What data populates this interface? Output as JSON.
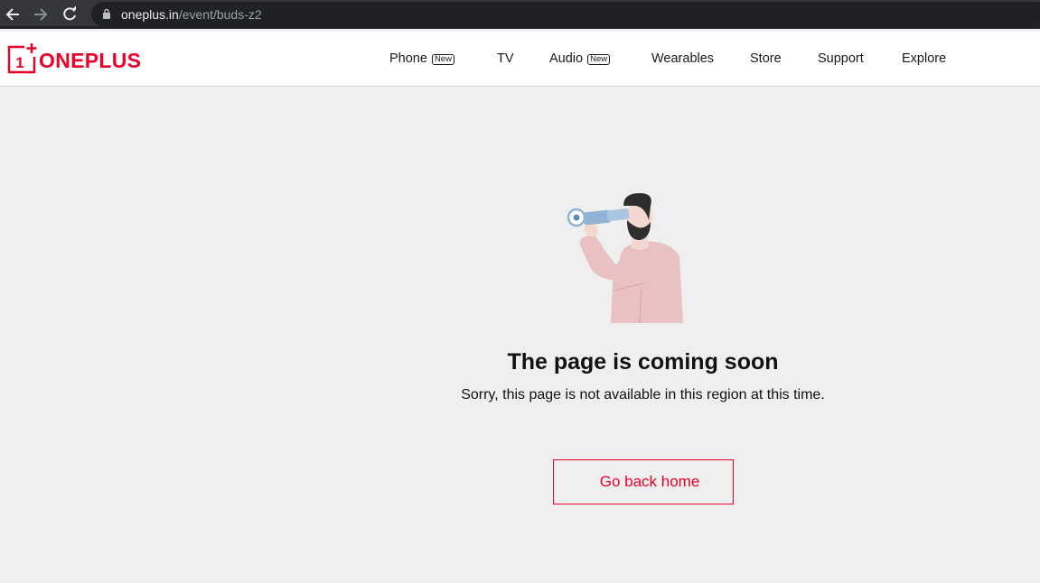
{
  "browser": {
    "url_host": "oneplus.in",
    "url_path": "/event/buds-z2"
  },
  "header": {
    "logo_text": "ONEPLUS",
    "logo_mark_text": "1",
    "nav": [
      {
        "label": "Phone",
        "badge": "New"
      },
      {
        "label": "TV"
      },
      {
        "label": "Audio",
        "badge": "New"
      },
      {
        "label": "Wearables"
      },
      {
        "label": "Store"
      },
      {
        "label": "Support"
      },
      {
        "label": "Explore"
      }
    ]
  },
  "main": {
    "title": "The page is coming soon",
    "subtitle": "Sorry, this page is not available in this region at this time.",
    "home_button_label": "Go back home"
  },
  "colors": {
    "brand_red": "#eb0028",
    "background": "#efefef",
    "shirt": "#e9c1c3",
    "telescope": "#8fb3d4"
  },
  "icons": [
    "arrow-left-icon",
    "arrow-right-icon",
    "reload-icon",
    "lock-icon",
    "oneplus-logo-icon",
    "man-with-telescope-illustration"
  ]
}
